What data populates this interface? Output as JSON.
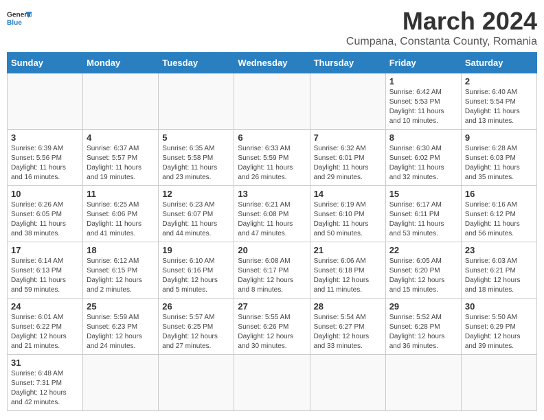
{
  "logo": {
    "general": "General",
    "blue": "Blue"
  },
  "title": "March 2024",
  "location": "Cumpana, Constanta County, Romania",
  "weekdays": [
    "Sunday",
    "Monday",
    "Tuesday",
    "Wednesday",
    "Thursday",
    "Friday",
    "Saturday"
  ],
  "weeks": [
    [
      {
        "day": "",
        "info": ""
      },
      {
        "day": "",
        "info": ""
      },
      {
        "day": "",
        "info": ""
      },
      {
        "day": "",
        "info": ""
      },
      {
        "day": "",
        "info": ""
      },
      {
        "day": "1",
        "info": "Sunrise: 6:42 AM\nSunset: 5:53 PM\nDaylight: 11 hours and 10 minutes."
      },
      {
        "day": "2",
        "info": "Sunrise: 6:40 AM\nSunset: 5:54 PM\nDaylight: 11 hours and 13 minutes."
      }
    ],
    [
      {
        "day": "3",
        "info": "Sunrise: 6:39 AM\nSunset: 5:56 PM\nDaylight: 11 hours and 16 minutes."
      },
      {
        "day": "4",
        "info": "Sunrise: 6:37 AM\nSunset: 5:57 PM\nDaylight: 11 hours and 19 minutes."
      },
      {
        "day": "5",
        "info": "Sunrise: 6:35 AM\nSunset: 5:58 PM\nDaylight: 11 hours and 23 minutes."
      },
      {
        "day": "6",
        "info": "Sunrise: 6:33 AM\nSunset: 5:59 PM\nDaylight: 11 hours and 26 minutes."
      },
      {
        "day": "7",
        "info": "Sunrise: 6:32 AM\nSunset: 6:01 PM\nDaylight: 11 hours and 29 minutes."
      },
      {
        "day": "8",
        "info": "Sunrise: 6:30 AM\nSunset: 6:02 PM\nDaylight: 11 hours and 32 minutes."
      },
      {
        "day": "9",
        "info": "Sunrise: 6:28 AM\nSunset: 6:03 PM\nDaylight: 11 hours and 35 minutes."
      }
    ],
    [
      {
        "day": "10",
        "info": "Sunrise: 6:26 AM\nSunset: 6:05 PM\nDaylight: 11 hours and 38 minutes."
      },
      {
        "day": "11",
        "info": "Sunrise: 6:25 AM\nSunset: 6:06 PM\nDaylight: 11 hours and 41 minutes."
      },
      {
        "day": "12",
        "info": "Sunrise: 6:23 AM\nSunset: 6:07 PM\nDaylight: 11 hours and 44 minutes."
      },
      {
        "day": "13",
        "info": "Sunrise: 6:21 AM\nSunset: 6:08 PM\nDaylight: 11 hours and 47 minutes."
      },
      {
        "day": "14",
        "info": "Sunrise: 6:19 AM\nSunset: 6:10 PM\nDaylight: 11 hours and 50 minutes."
      },
      {
        "day": "15",
        "info": "Sunrise: 6:17 AM\nSunset: 6:11 PM\nDaylight: 11 hours and 53 minutes."
      },
      {
        "day": "16",
        "info": "Sunrise: 6:16 AM\nSunset: 6:12 PM\nDaylight: 11 hours and 56 minutes."
      }
    ],
    [
      {
        "day": "17",
        "info": "Sunrise: 6:14 AM\nSunset: 6:13 PM\nDaylight: 11 hours and 59 minutes."
      },
      {
        "day": "18",
        "info": "Sunrise: 6:12 AM\nSunset: 6:15 PM\nDaylight: 12 hours and 2 minutes."
      },
      {
        "day": "19",
        "info": "Sunrise: 6:10 AM\nSunset: 6:16 PM\nDaylight: 12 hours and 5 minutes."
      },
      {
        "day": "20",
        "info": "Sunrise: 6:08 AM\nSunset: 6:17 PM\nDaylight: 12 hours and 8 minutes."
      },
      {
        "day": "21",
        "info": "Sunrise: 6:06 AM\nSunset: 6:18 PM\nDaylight: 12 hours and 11 minutes."
      },
      {
        "day": "22",
        "info": "Sunrise: 6:05 AM\nSunset: 6:20 PM\nDaylight: 12 hours and 15 minutes."
      },
      {
        "day": "23",
        "info": "Sunrise: 6:03 AM\nSunset: 6:21 PM\nDaylight: 12 hours and 18 minutes."
      }
    ],
    [
      {
        "day": "24",
        "info": "Sunrise: 6:01 AM\nSunset: 6:22 PM\nDaylight: 12 hours and 21 minutes."
      },
      {
        "day": "25",
        "info": "Sunrise: 5:59 AM\nSunset: 6:23 PM\nDaylight: 12 hours and 24 minutes."
      },
      {
        "day": "26",
        "info": "Sunrise: 5:57 AM\nSunset: 6:25 PM\nDaylight: 12 hours and 27 minutes."
      },
      {
        "day": "27",
        "info": "Sunrise: 5:55 AM\nSunset: 6:26 PM\nDaylight: 12 hours and 30 minutes."
      },
      {
        "day": "28",
        "info": "Sunrise: 5:54 AM\nSunset: 6:27 PM\nDaylight: 12 hours and 33 minutes."
      },
      {
        "day": "29",
        "info": "Sunrise: 5:52 AM\nSunset: 6:28 PM\nDaylight: 12 hours and 36 minutes."
      },
      {
        "day": "30",
        "info": "Sunrise: 5:50 AM\nSunset: 6:29 PM\nDaylight: 12 hours and 39 minutes."
      }
    ],
    [
      {
        "day": "31",
        "info": "Sunrise: 6:48 AM\nSunset: 7:31 PM\nDaylight: 12 hours and 42 minutes."
      },
      {
        "day": "",
        "info": ""
      },
      {
        "day": "",
        "info": ""
      },
      {
        "day": "",
        "info": ""
      },
      {
        "day": "",
        "info": ""
      },
      {
        "day": "",
        "info": ""
      },
      {
        "day": "",
        "info": ""
      }
    ]
  ]
}
